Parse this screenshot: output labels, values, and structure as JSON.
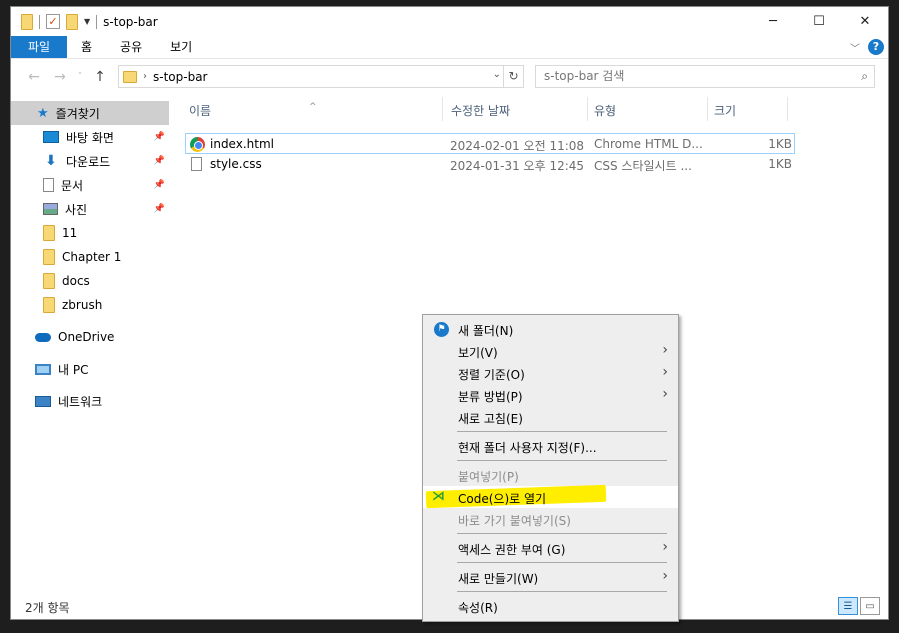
{
  "window": {
    "title": "s-top-bar",
    "controls": {
      "minimize": "─",
      "maximize": "☐",
      "close": "✕"
    }
  },
  "ribbon": {
    "tabs": [
      "파일",
      "홈",
      "공유",
      "보기"
    ],
    "help": "?"
  },
  "nav": {
    "back": "←",
    "forward": "→",
    "up": "↑",
    "path": "s-top-bar",
    "search_placeholder": "s-top-bar 검색"
  },
  "sidebar": {
    "quick_access": "즐겨찾기",
    "items": [
      {
        "label": "바탕 화면",
        "icon": "desktop-icon",
        "pinned": true
      },
      {
        "label": "다운로드",
        "icon": "download-icon",
        "pinned": true
      },
      {
        "label": "문서",
        "icon": "document-icon",
        "pinned": true
      },
      {
        "label": "사진",
        "icon": "pictures-icon",
        "pinned": true
      },
      {
        "label": "11",
        "icon": "folder-icon",
        "pinned": false
      },
      {
        "label": "Chapter 1",
        "icon": "folder-icon",
        "pinned": false
      },
      {
        "label": "docs",
        "icon": "folder-icon",
        "pinned": false
      },
      {
        "label": "zbrush",
        "icon": "folder-icon",
        "pinned": false
      }
    ],
    "onedrive": "OneDrive",
    "this_pc": "내 PC",
    "network": "네트워크"
  },
  "columns": {
    "name": "이름",
    "modified": "수정한 날짜",
    "type": "유형",
    "size": "크기"
  },
  "files": [
    {
      "name": "index.html",
      "modified": "2024-02-01 오전 11:08",
      "type": "Chrome HTML D...",
      "size": "1KB",
      "icon": "chrome-icon"
    },
    {
      "name": "style.css",
      "modified": "2024-01-31 오후 12:45",
      "type": "CSS 스타일시트 ...",
      "size": "1KB",
      "icon": "css-file-icon"
    }
  ],
  "status": {
    "count": "2개 항목"
  },
  "context_menu": {
    "new_folder": "새 폴더(N)",
    "view": "보기(V)",
    "sort_by": "정렬 기준(O)",
    "group_by": "분류 방법(P)",
    "refresh": "새로 고침(E)",
    "customize": "현재 폴더 사용자 지정(F)...",
    "paste": "붙여넣기(P)",
    "open_code": "Code(으)로 열기",
    "paste_shortcut": "바로 가기 붙여넣기(S)",
    "give_access": "액세스 권한 부여 (G)",
    "new": "새로 만들기(W)",
    "properties": "속성(R)"
  },
  "colors": {
    "accent": "#1979ca",
    "highlight": "#ffee00",
    "selection": "#cce8ff"
  }
}
